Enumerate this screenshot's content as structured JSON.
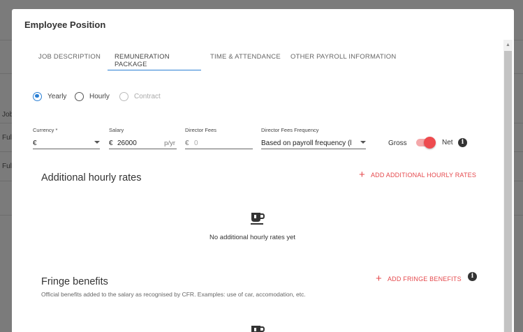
{
  "backdrop": {
    "rows": [
      "Job",
      "Full",
      "Full"
    ]
  },
  "modal": {
    "title": "Employee Position"
  },
  "tabs": [
    {
      "label": "JOB DESCRIPTION",
      "active": false
    },
    {
      "label": "REMUNERATION PACKAGE",
      "active": true
    },
    {
      "label": "TIME & ATTENDANCE",
      "active": false
    },
    {
      "label": "OTHER PAYROLL INFORMATION",
      "active": false
    }
  ],
  "pay_type": {
    "options": [
      {
        "label": "Yearly",
        "selected": true,
        "disabled": false
      },
      {
        "label": "Hourly",
        "selected": false,
        "disabled": false
      },
      {
        "label": "Contract",
        "selected": false,
        "disabled": true
      }
    ]
  },
  "fields": {
    "currency": {
      "label": "Currency *",
      "value": "€"
    },
    "salary": {
      "label": "Salary",
      "prefix": "€",
      "value": "26000",
      "suffix": "p/yr"
    },
    "director_fees": {
      "label": "Director Fees",
      "prefix": "€",
      "placeholder": "0"
    },
    "director_fees_frequency": {
      "label": "Director Fees Frequency",
      "value": "Based on payroll frequency (l"
    }
  },
  "gross_net_toggle": {
    "left_label": "Gross",
    "right_label": "Net",
    "state": "Net"
  },
  "additional_hourly_rates": {
    "title": "Additional hourly rates",
    "add_label": "ADD ADDITIONAL HOURLY RATES",
    "empty_text": "No additional hourly rates yet"
  },
  "fringe_benefits": {
    "title": "Fringe benefits",
    "description": "Official benefits added to the salary as recognised by CFR. Examples: use of car, accomodation, etc.",
    "add_label": "ADD FRINGE BENEFITS"
  },
  "colors": {
    "accent_blue": "#2a7fd4",
    "accent_red": "#e5484c",
    "toggle_on": "#ee4b4f"
  },
  "icons": {
    "empty_state": "coffee-cup-icon",
    "info": "info-icon",
    "add": "plus-icon"
  }
}
